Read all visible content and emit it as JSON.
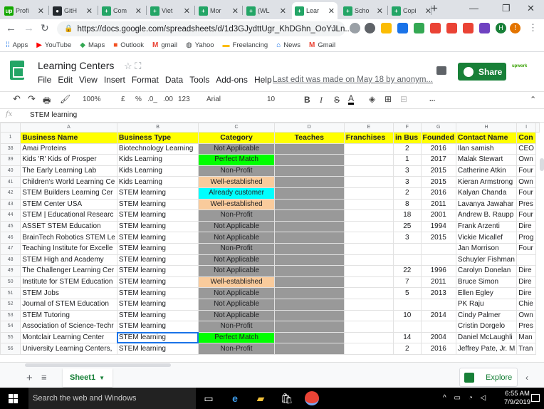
{
  "browser": {
    "tabs": [
      {
        "label": "Profi",
        "color": "#14a800",
        "glyph": "up"
      },
      {
        "label": "GitH",
        "color": "#24292e",
        "glyph": "●"
      },
      {
        "label": "Com",
        "color": "#23a566",
        "glyph": "+"
      },
      {
        "label": "Viet",
        "color": "#23a566",
        "glyph": "+"
      },
      {
        "label": "Mor",
        "color": "#23a566",
        "glyph": "+"
      },
      {
        "label": "(WL",
        "color": "#23a566",
        "glyph": "+"
      },
      {
        "label": "Lear",
        "color": "#23a566",
        "glyph": "+"
      },
      {
        "label": "Scho",
        "color": "#23a566",
        "glyph": "+"
      },
      {
        "label": "Copi",
        "color": "#23a566",
        "glyph": "+"
      }
    ],
    "url": "https://docs.google.com/spreadsheets/d/1d3GJydttUgr_KhDGhn_OoYJLn...",
    "bookmarks": [
      "Apps",
      "YouTube",
      "Maps",
      "Outlook",
      "gmail",
      "Yahoo",
      "Freelancing",
      "News",
      "Gmail"
    ]
  },
  "doc": {
    "title": "Learning Centers",
    "menus": [
      "File",
      "Edit",
      "View",
      "Insert",
      "Format",
      "Data",
      "Tools",
      "Add-ons",
      "Help"
    ],
    "last_edit": "Last edit was made on May 18 by anonym...",
    "share_label": "Share",
    "upwork": "upwork"
  },
  "toolbar": {
    "zoom": "100%",
    "currency": "£",
    "percent": "%",
    "dec1": ".0_",
    "dec2": ".00",
    "format": "123",
    "font": "Arial",
    "size": "10",
    "bold": "B",
    "italic": "I",
    "strike": "S",
    "color": "A",
    "more": "..."
  },
  "formula": {
    "fx": "fx",
    "value": "STEM learning"
  },
  "columns": [
    "A",
    "B",
    "C",
    "D",
    "E",
    "F",
    "G",
    "H",
    "I"
  ],
  "header": {
    "num": "1",
    "cells": [
      "Business Name",
      "Business Type",
      "Category",
      "Teaches",
      "Franchises",
      "in Bus",
      "Founded",
      "Contact Name",
      "Con"
    ]
  },
  "rows": [
    {
      "n": "38",
      "name": "Amai Proteins",
      "type": "Biotechnology Learning",
      "cat": "Not Applicable",
      "cls": "grey",
      "bus": "2",
      "founded": "2016",
      "contact": "Ilan samish",
      "con": "CEO"
    },
    {
      "n": "39",
      "name": "Kids 'R' Kids of Prosper",
      "type": "Kids Learning",
      "cat": "Perfect Match",
      "cls": "green",
      "bus": "1",
      "founded": "2017",
      "contact": "Malak Stewart",
      "con": "Own"
    },
    {
      "n": "40",
      "name": "The Early Learning Lab",
      "type": "Kids Learning",
      "cat": "Non-Profit",
      "cls": "grey",
      "bus": "3",
      "founded": "2015",
      "contact": "Catherine Atkin",
      "con": "Four"
    },
    {
      "n": "41",
      "name": "Children's World Learning Ce",
      "type": "Kids Learning",
      "cat": "Well-established",
      "cls": "peach",
      "bus": "3",
      "founded": "2015",
      "contact": "Kieran Armstrong",
      "con": "Own"
    },
    {
      "n": "42",
      "name": "STEM Builders Learning Cer",
      "type": "STEM learning",
      "cat": "Already customer",
      "cls": "cyan",
      "bus": "2",
      "founded": "2016",
      "contact": "Kalyan Chanda",
      "con": "Four"
    },
    {
      "n": "43",
      "name": "STEM Center USA",
      "type": "STEM learning",
      "cat": "Well-established",
      "cls": "peach",
      "bus": "8",
      "founded": "2011",
      "contact": "Lavanya Jawahar",
      "con": "Pres"
    },
    {
      "n": "44",
      "name": "STEM | Educational Researc",
      "type": "STEM learning",
      "cat": "Non-Profit",
      "cls": "grey",
      "bus": "18",
      "founded": "2001",
      "contact": "Andrew B. Raupp",
      "con": "Four"
    },
    {
      "n": "45",
      "name": "ASSET STEM Education",
      "type": "STEM learning",
      "cat": "Not Applicable",
      "cls": "grey",
      "bus": "25",
      "founded": "1994",
      "contact": "Frank Arzenti",
      "con": "Dire"
    },
    {
      "n": "46",
      "name": "BrainTech Robotics STEM Le",
      "type": "STEM learning",
      "cat": "Not Applicable",
      "cls": "grey",
      "bus": "3",
      "founded": "2015",
      "contact": "Vickie Micallef",
      "con": "Prog"
    },
    {
      "n": "47",
      "name": "Teaching Institute for Excelle",
      "type": "STEM learning",
      "cat": "Non-Profit",
      "cls": "grey",
      "bus": "",
      "founded": "",
      "contact": "Jan Morrison",
      "con": "Four"
    },
    {
      "n": "48",
      "name": "STEM High and Academy",
      "type": "STEM learning",
      "cat": "Not Applicable",
      "cls": "grey",
      "bus": "",
      "founded": "",
      "contact": "Schuyler Fishman",
      "con": ""
    },
    {
      "n": "49",
      "name": "The Challenger Learning Cer",
      "type": "STEM learning",
      "cat": "Not Applicable",
      "cls": "grey",
      "bus": "22",
      "founded": "1996",
      "contact": "Carolyn Donelan",
      "con": "Dire"
    },
    {
      "n": "50",
      "name": "Institute for STEM Education",
      "type": "STEM learning",
      "cat": "Well-established",
      "cls": "peach",
      "bus": "7",
      "founded": "2011",
      "contact": "Bruce Simon",
      "con": "Dire"
    },
    {
      "n": "51",
      "name": "STEM Jobs",
      "type": "STEM learning",
      "cat": "Not Applicable",
      "cls": "grey",
      "bus": "5",
      "founded": "2013",
      "contact": "Ellen Egley",
      "con": "Dire"
    },
    {
      "n": "52",
      "name": "Journal of STEM Education",
      "type": "STEM learning",
      "cat": "Not Applicable",
      "cls": "grey",
      "bus": "",
      "founded": "",
      "contact": "PK Raju",
      "con": "Chie"
    },
    {
      "n": "53",
      "name": "STEM Tutoring",
      "type": "STEM learning",
      "cat": "Not Applicable",
      "cls": "grey",
      "bus": "10",
      "founded": "2014",
      "contact": "Cindy Palmer",
      "con": "Own"
    },
    {
      "n": "54",
      "name": "Association of Science-Techr",
      "type": "STEM learning",
      "cat": "Non-Profit",
      "cls": "grey",
      "bus": "",
      "founded": "",
      "contact": "Cristin Dorgelo",
      "con": "Pres"
    },
    {
      "n": "55",
      "name": "Montclair Learning Center",
      "type": "STEM learning",
      "cat": "Perfect Match",
      "cls": "green",
      "bus": "14",
      "founded": "2004",
      "contact": "Daniel McLaughli",
      "con": "Man"
    },
    {
      "n": "56",
      "name": "University Learning Centers,",
      "type": "STEM learning",
      "cat": "Non-Profit",
      "cls": "grey",
      "bus": "2",
      "founded": "2016",
      "contact": "Jeffrey Pate, Jr. M",
      "con": "Tran"
    }
  ],
  "sheet_tab": "Sheet1",
  "explore": "Explore",
  "taskbar": {
    "search": "Search the web and Windows",
    "time": "6:55 AM",
    "date": "7/9/2019"
  }
}
